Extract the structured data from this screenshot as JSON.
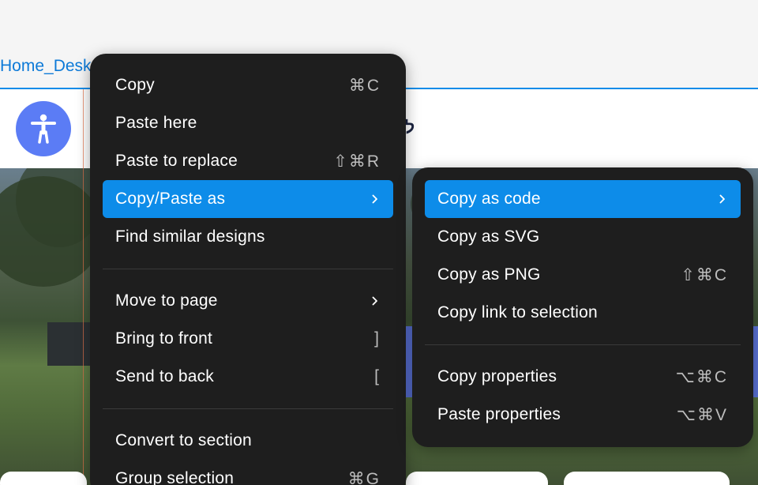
{
  "frame": {
    "label": "Home_Desk",
    "hebrew_text": "לר"
  },
  "main_menu": {
    "items_group1": [
      {
        "label": "Copy",
        "shortcut": "⌘C"
      },
      {
        "label": "Paste here",
        "shortcut": ""
      },
      {
        "label": "Paste to replace",
        "shortcut": "⇧⌘R"
      },
      {
        "label": "Copy/Paste as",
        "shortcut": "",
        "submenu": true,
        "active": true
      },
      {
        "label": "Find similar designs",
        "shortcut": ""
      }
    ],
    "items_group2": [
      {
        "label": "Move to page",
        "shortcut": "",
        "submenu": true
      },
      {
        "label": "Bring to front",
        "shortcut": "]"
      },
      {
        "label": "Send to back",
        "shortcut": "["
      }
    ],
    "items_group3": [
      {
        "label": "Convert to section",
        "shortcut": ""
      },
      {
        "label": "Group selection",
        "shortcut": "⌘G"
      }
    ]
  },
  "sub_menu": {
    "items_group1": [
      {
        "label": "Copy as code",
        "shortcut": "",
        "submenu": true,
        "active": true
      },
      {
        "label": "Copy as SVG",
        "shortcut": ""
      },
      {
        "label": "Copy as PNG",
        "shortcut": "⇧⌘C"
      },
      {
        "label": "Copy link to selection",
        "shortcut": ""
      }
    ],
    "items_group2": [
      {
        "label": "Copy properties",
        "shortcut": "⌥⌘C"
      },
      {
        "label": "Paste properties",
        "shortcut": "⌥⌘V"
      }
    ]
  },
  "colors": {
    "menu_bg": "#1e1e1e",
    "highlight": "#0d8ce9",
    "frame_label": "#0d7ad8",
    "accessibility_button": "#5b7cf5"
  },
  "icons": {
    "accessibility": "accessibility-person-icon",
    "submenu": "chevron-right-icon"
  }
}
